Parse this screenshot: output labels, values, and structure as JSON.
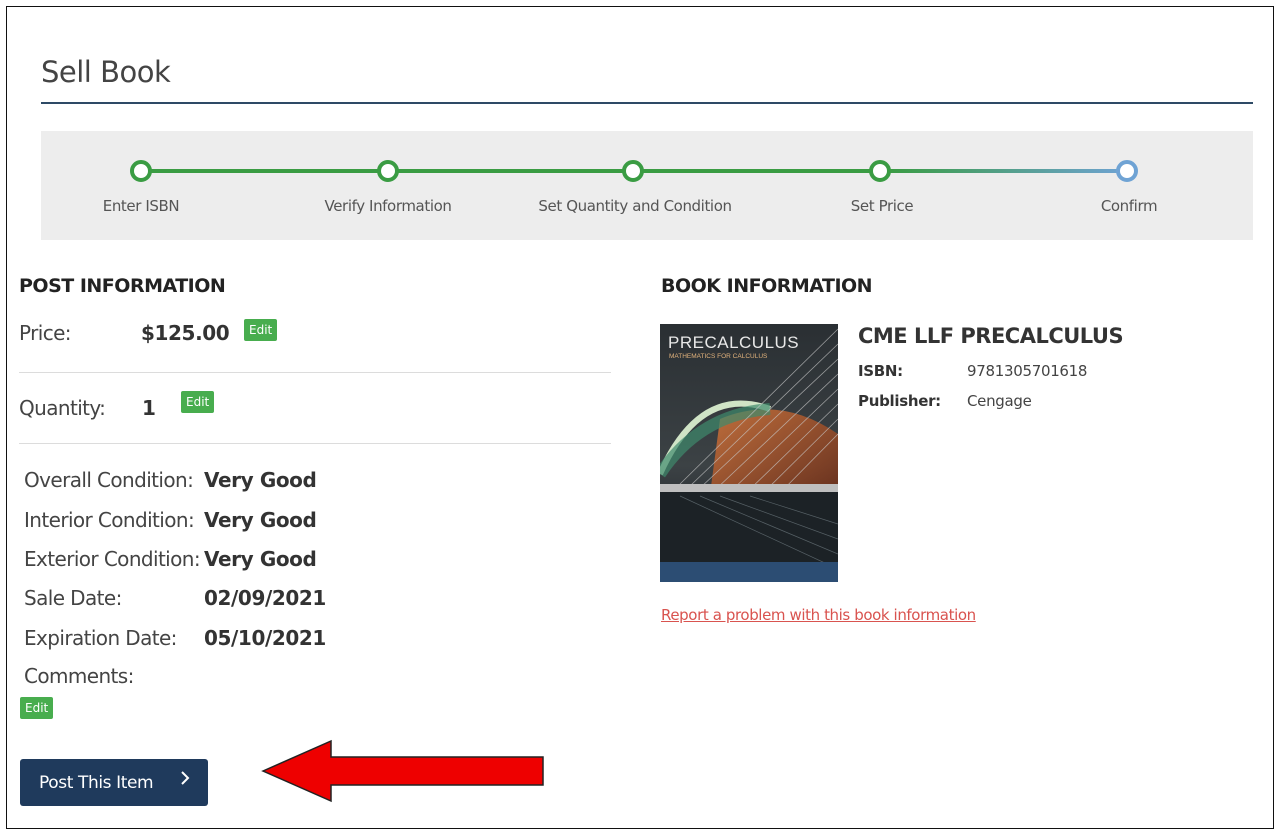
{
  "page": {
    "title": "Sell Book"
  },
  "stepper": {
    "steps": [
      {
        "label": "Enter ISBN",
        "state": "done"
      },
      {
        "label": "Verify Information",
        "state": "done"
      },
      {
        "label": "Set Quantity and Condition",
        "state": "done"
      },
      {
        "label": "Set Price",
        "state": "done"
      },
      {
        "label": "Confirm",
        "state": "current"
      }
    ],
    "colors": {
      "done": "#3a9c43",
      "current": "#6fa3d4"
    }
  },
  "post_info": {
    "heading": "POST INFORMATION",
    "price": {
      "label": "Price:",
      "value": "$125.00",
      "edit_label": "Edit"
    },
    "quantity": {
      "label": "Quantity:",
      "value": "1",
      "edit_label": "Edit"
    },
    "conditions": [
      {
        "label": "Overall Condition:",
        "value": "Very Good"
      },
      {
        "label": "Interior Condition:",
        "value": "Very Good"
      },
      {
        "label": "Exterior Condition:",
        "value": "Very Good"
      },
      {
        "label": "Sale Date:",
        "value": "02/09/2021"
      },
      {
        "label": "Expiration Date:",
        "value": "05/10/2021"
      }
    ],
    "comments": {
      "label": "Comments:",
      "value": "",
      "edit_label": "Edit"
    },
    "post_button_label": "Post This Item"
  },
  "book_info": {
    "heading": "BOOK INFORMATION",
    "title": "CME LLF PRECALCULUS",
    "isbn": {
      "label": "ISBN:",
      "value": "9781305701618"
    },
    "publisher": {
      "label": "Publisher:",
      "value": "Cengage"
    },
    "cover": {
      "title": "PRECALCULUS",
      "subtitle": "MATHEMATICS FOR CALCULUS"
    },
    "report_link": "Report a problem with this book information"
  },
  "colors": {
    "accent": "#1f3a5c",
    "edit_green": "#48ad4e",
    "link_red": "#d9534f",
    "annotation_arrow": "#ee0000"
  }
}
